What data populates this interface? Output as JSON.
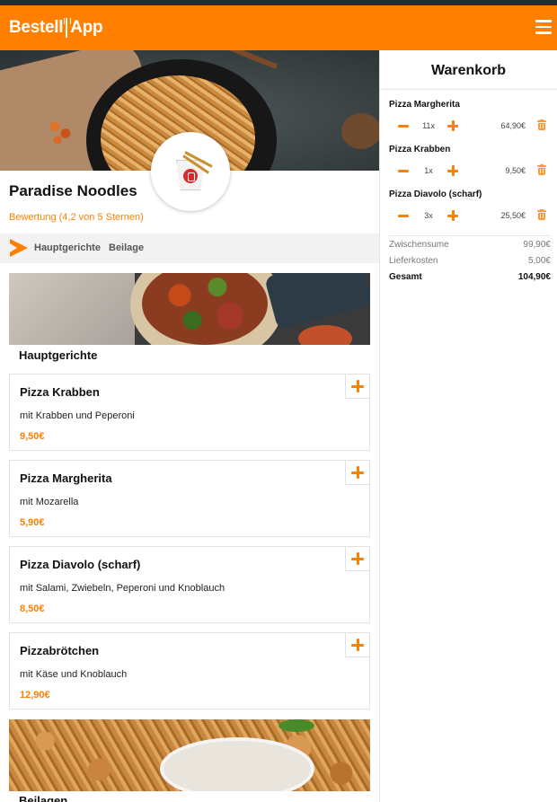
{
  "header": {
    "logo_part1": "Bestell",
    "logo_part2": "App",
    "brand_color": "#ff8000",
    "menu_icon": "hamburger-menu-icon"
  },
  "restaurant": {
    "name": "Paradise Noodles",
    "rating_text": "Bewertung (4,2 von 5 Sternen)",
    "logo_icon": "takeout-box-icon"
  },
  "categories": {
    "arrow_icon": "arrow-right-icon",
    "items": [
      "Hauptgerichte",
      "Beilage"
    ]
  },
  "sections": [
    {
      "title": "Hauptgerichte",
      "dishes": [
        {
          "name": "Pizza Krabben",
          "description": "mit Krabben und Peperoni",
          "price": "9,50€"
        },
        {
          "name": "Pizza Margherita",
          "description": "mit Mozarella",
          "price": "5,90€"
        },
        {
          "name": "Pizza Diavolo (scharf)",
          "description": "mit Salami, Zwiebeln, Peperoni und Knoblauch",
          "price": "8,50€"
        },
        {
          "name": "Pizzabrötchen",
          "description": "mit Käse und Knoblauch",
          "price": "12,90€"
        }
      ]
    },
    {
      "title": "Beilagen"
    }
  ],
  "cart": {
    "title": "Warenkorb",
    "items": [
      {
        "name": "Pizza Margherita",
        "quantity": "11x",
        "price": "64,90€"
      },
      {
        "name": "Pizza Krabben",
        "quantity": "1x",
        "price": "9,50€"
      },
      {
        "name": "Pizza Diavolo (scharf)",
        "quantity": "3x",
        "price": "25,50€"
      }
    ],
    "subtotal_label": "Zwischensume",
    "subtotal": "99,90€",
    "delivery_label": "Lieferkosten",
    "delivery": "5,00€",
    "total_label": "Gesamt",
    "total": "104,90€"
  }
}
